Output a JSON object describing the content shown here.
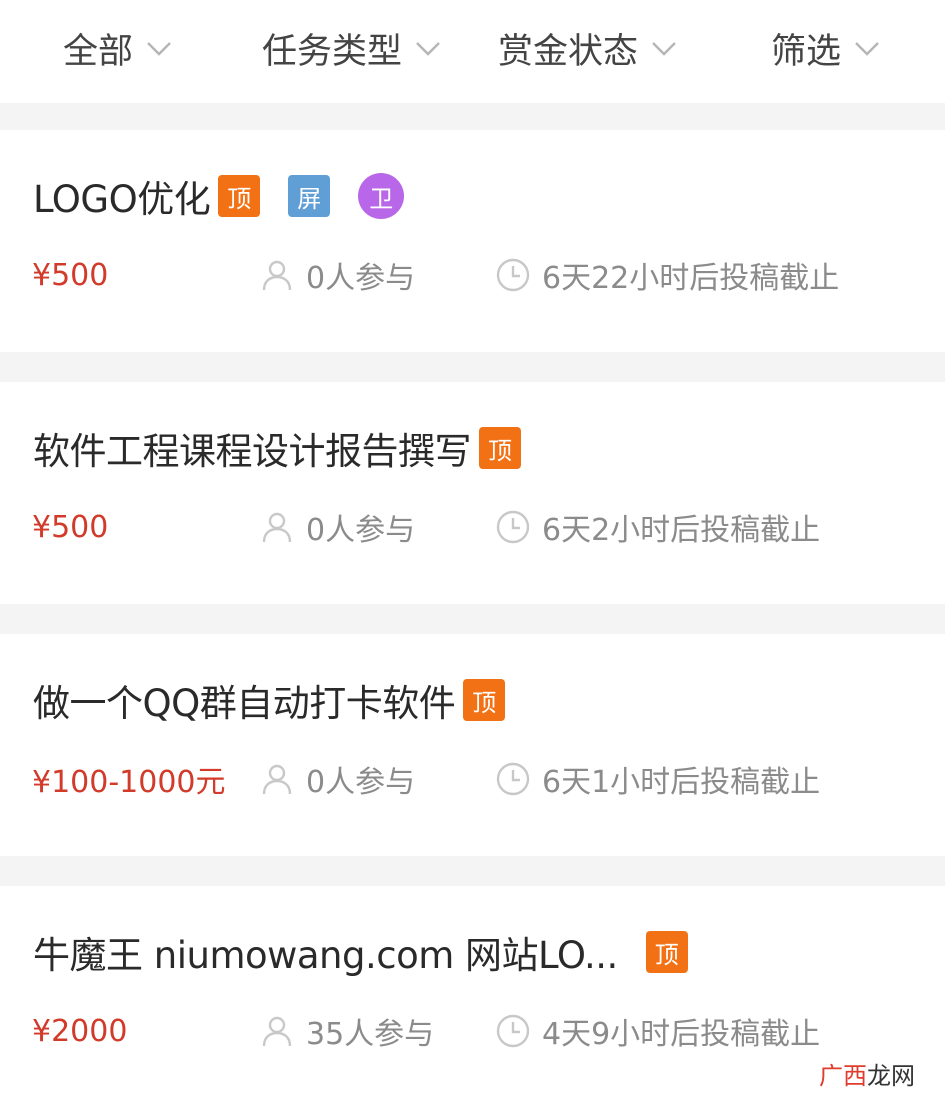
{
  "filters": [
    {
      "label": "全部"
    },
    {
      "label": "任务类型"
    },
    {
      "label": "赏金状态"
    },
    {
      "label": "筛选"
    }
  ],
  "tasks": [
    {
      "title": "LOGO优化",
      "badges": [
        "顶",
        "屏",
        "卫"
      ],
      "price": "¥500",
      "participants": "0人参与",
      "deadline": "6天22小时后投稿截止"
    },
    {
      "title": "软件工程课程设计报告撰写",
      "badges": [
        "顶"
      ],
      "price": "¥500",
      "participants": "0人参与",
      "deadline": "6天2小时后投稿截止"
    },
    {
      "title": "做一个QQ群自动打卡软件",
      "badges": [
        "顶"
      ],
      "price": "¥100-1000元",
      "participants": "0人参与",
      "deadline": "6天1小时后投稿截止"
    },
    {
      "title": "牛魔王 niumowang.com 网站LO...",
      "badges": [
        "顶"
      ],
      "price": "¥2000",
      "participants": "35人参与",
      "deadline": "4天9小时后投稿截止"
    }
  ],
  "watermark": {
    "part1": "广西",
    "part2": "龙网"
  },
  "colors": {
    "price": "#d23a2a",
    "badge_top": "#f27114",
    "badge_screen": "#5f9fd6",
    "badge_guard": "#b867e8",
    "muted_text": "#8b8b8b"
  }
}
